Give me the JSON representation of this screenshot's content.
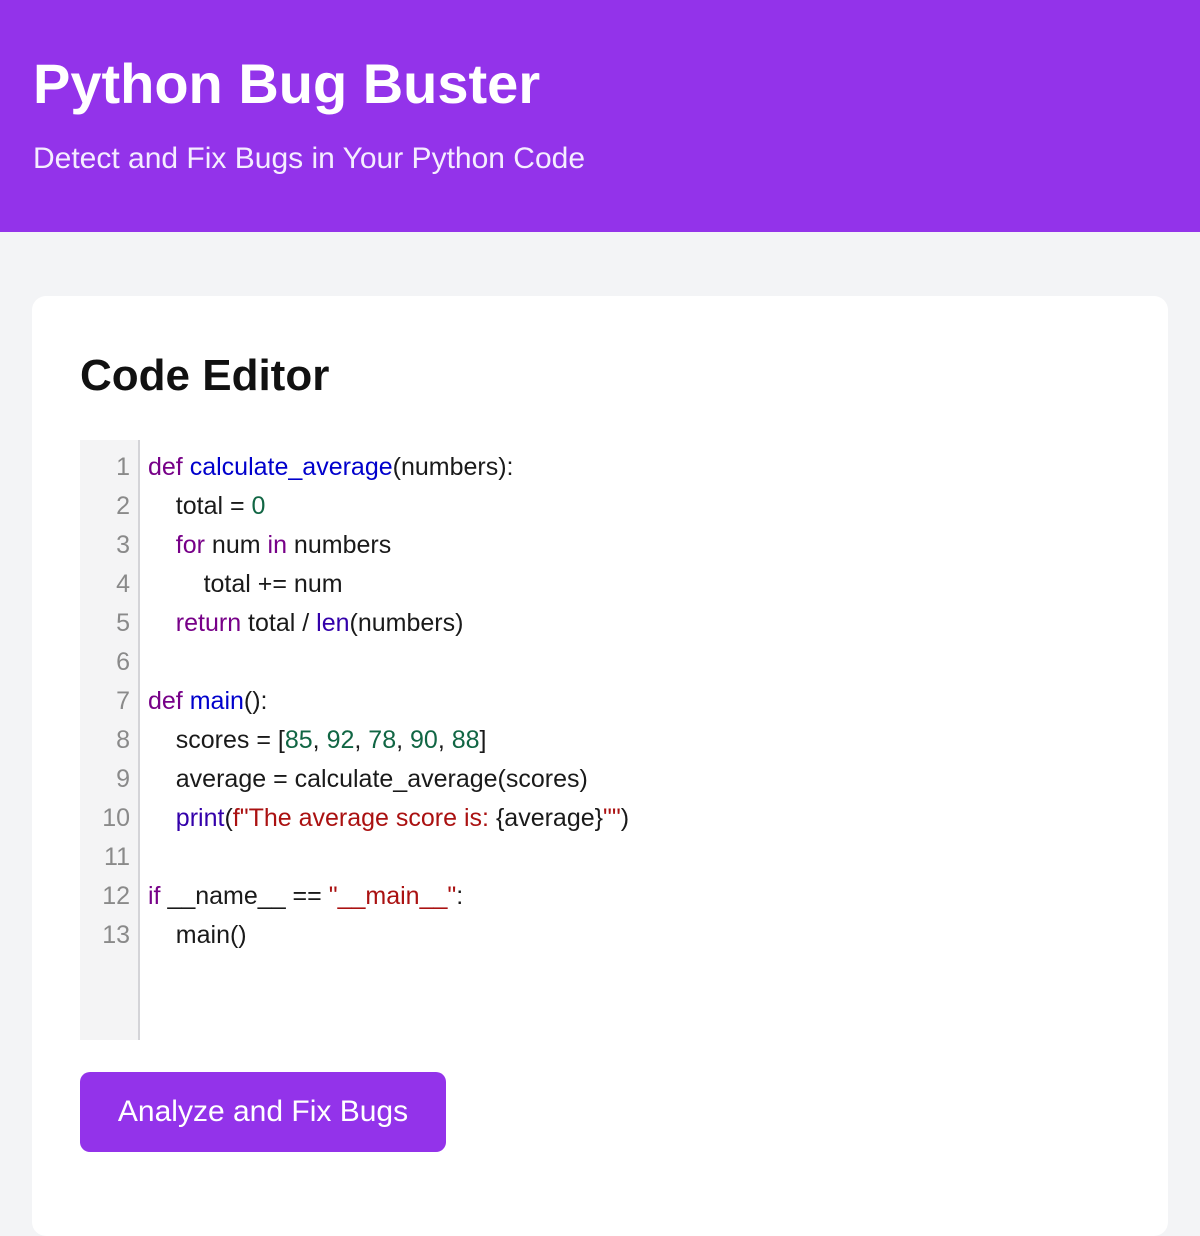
{
  "header": {
    "title": "Python Bug Buster",
    "subtitle": "Detect and Fix Bugs in Your Python Code"
  },
  "colors": {
    "brand": "#9333ea",
    "background": "#f3f4f6",
    "keyword": "#770088",
    "function_name": "#0000cc",
    "number": "#116644",
    "builtin": "#3300aa",
    "string": "#aa1111"
  },
  "editor": {
    "title": "Code Editor",
    "line_numbers": [
      "1",
      "2",
      "3",
      "4",
      "5",
      "6",
      "7",
      "8",
      "9",
      "10",
      "11",
      "12",
      "13"
    ],
    "lines": [
      [
        {
          "t": "def",
          "c": "kw"
        },
        {
          "t": " "
        },
        {
          "t": "calculate_average",
          "c": "def"
        },
        {
          "t": "(numbers):"
        }
      ],
      [
        {
          "t": "    total = "
        },
        {
          "t": "0",
          "c": "num"
        }
      ],
      [
        {
          "t": "    "
        },
        {
          "t": "for",
          "c": "kw"
        },
        {
          "t": " num "
        },
        {
          "t": "in",
          "c": "kw"
        },
        {
          "t": " numbers"
        }
      ],
      [
        {
          "t": "        total += num"
        }
      ],
      [
        {
          "t": "    "
        },
        {
          "t": "return",
          "c": "kw"
        },
        {
          "t": " total / "
        },
        {
          "t": "len",
          "c": "bi"
        },
        {
          "t": "(numbers)"
        }
      ],
      [],
      [
        {
          "t": "def",
          "c": "kw"
        },
        {
          "t": " "
        },
        {
          "t": "main",
          "c": "def"
        },
        {
          "t": "():"
        }
      ],
      [
        {
          "t": "    scores = ["
        },
        {
          "t": "85",
          "c": "num"
        },
        {
          "t": ", "
        },
        {
          "t": "92",
          "c": "num"
        },
        {
          "t": ", "
        },
        {
          "t": "78",
          "c": "num"
        },
        {
          "t": ", "
        },
        {
          "t": "90",
          "c": "num"
        },
        {
          "t": ", "
        },
        {
          "t": "88",
          "c": "num"
        },
        {
          "t": "]"
        }
      ],
      [
        {
          "t": "    average = calculate_average(scores)"
        }
      ],
      [
        {
          "t": "    "
        },
        {
          "t": "print",
          "c": "bi"
        },
        {
          "t": "("
        },
        {
          "t": "f\"The average score is: ",
          "c": "str"
        },
        {
          "t": "{average}"
        },
        {
          "t": "\"\"",
          "c": "str"
        },
        {
          "t": ")"
        }
      ],
      [],
      [
        {
          "t": "if",
          "c": "kw"
        },
        {
          "t": " __name__ == "
        },
        {
          "t": "\"__main__\"",
          "c": "str"
        },
        {
          "t": ":"
        }
      ],
      [
        {
          "t": "    main()"
        }
      ]
    ]
  },
  "actions": {
    "analyze_label": "Analyze and Fix Bugs"
  }
}
